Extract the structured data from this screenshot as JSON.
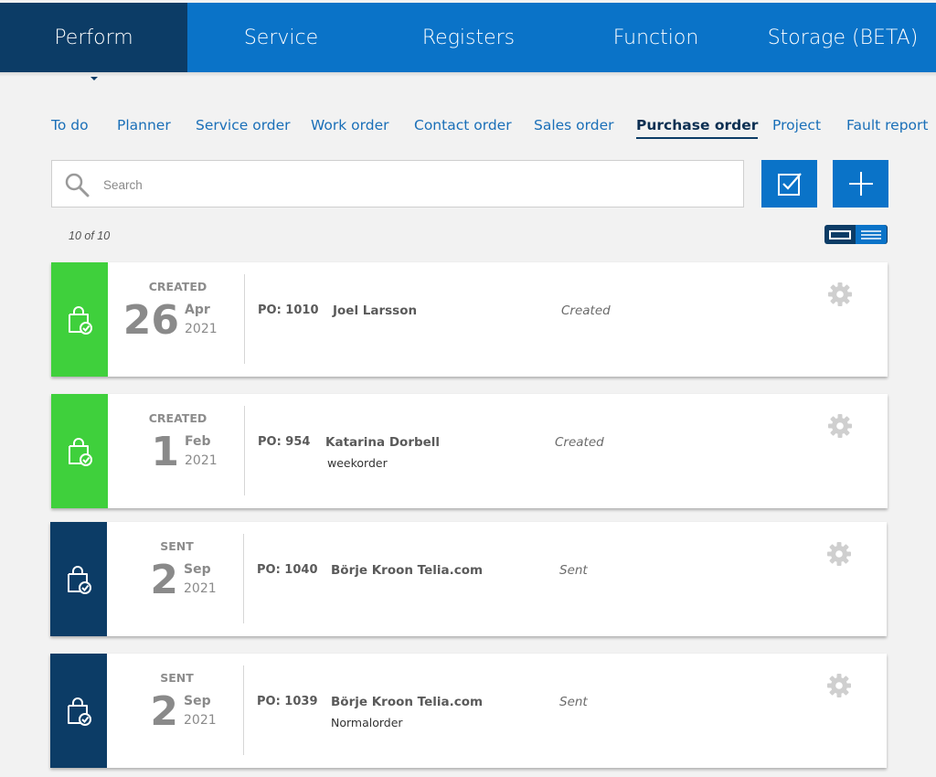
{
  "topnav": {
    "tabs": [
      {
        "label": "Perform",
        "active": true
      },
      {
        "label": "Service",
        "active": false
      },
      {
        "label": "Registers",
        "active": false
      },
      {
        "label": "Function",
        "active": false
      },
      {
        "label": "Storage (BETA)",
        "active": false
      }
    ]
  },
  "subnav": {
    "items": [
      {
        "label": "To do"
      },
      {
        "label": "Planner"
      },
      {
        "label": "Service order"
      },
      {
        "label": "Work order"
      },
      {
        "label": "Contact order"
      },
      {
        "label": "Sales order"
      },
      {
        "label": "Purchase order",
        "active": true
      },
      {
        "label": "Project"
      },
      {
        "label": "Fault report"
      }
    ]
  },
  "search": {
    "placeholder": "Search",
    "value": ""
  },
  "toolbar": {
    "check_icon": "checkbox-check-icon",
    "add_icon": "plus-icon"
  },
  "list": {
    "count": "10 of 10"
  },
  "colors": {
    "created": "#3fd03c",
    "sent": "#0c3c66",
    "accent": "#0a73c8"
  },
  "orders": [
    {
      "status": "CREATED",
      "day": "26",
      "month": "Apr",
      "year": "2021",
      "po": "PO: 1010",
      "name": "Joel Larsson",
      "sub": "",
      "state": "Created",
      "icon": "shopping-bag-check-icon"
    },
    {
      "status": "CREATED",
      "day": "1",
      "month": "Feb",
      "year": "2021",
      "po": "PO: 954",
      "name": "Katarina Dorbell",
      "sub": "weekorder",
      "state": "Created",
      "icon": "shopping-bag-check-icon"
    },
    {
      "status": "SENT",
      "day": "2",
      "month": "Sep",
      "year": "2021",
      "po": "PO: 1040",
      "name": "Börje Kroon Telia.com",
      "sub": "",
      "state": "Sent",
      "icon": "shopping-bag-check-icon"
    },
    {
      "status": "SENT",
      "day": "2",
      "month": "Sep",
      "year": "2021",
      "po": "PO: 1039",
      "name": "Börje Kroon Telia.com",
      "sub": "Normalorder",
      "state": "Sent",
      "icon": "shopping-bag-check-icon"
    }
  ]
}
